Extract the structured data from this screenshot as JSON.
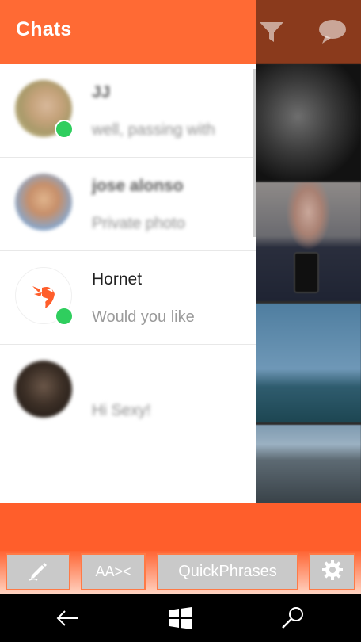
{
  "drawer": {
    "title": "Chats"
  },
  "chats": [
    {
      "name": "JJ",
      "preview": "well, passing with",
      "online": true
    },
    {
      "name": "jose alonso",
      "preview": "Private photo",
      "online": false
    },
    {
      "name": "Hornet",
      "preview": "Would you like",
      "online": true
    },
    {
      "name": "",
      "preview": "Hi Sexy!",
      "online": false
    }
  ],
  "action_bar": {
    "compose_icon": "pencil-icon",
    "text_size_label": "AA><",
    "quickphrases_label": "QuickPhrases",
    "settings_icon": "gear-icon"
  },
  "header_icons": [
    "filter-icon",
    "chat-bubble-icon"
  ],
  "system_nav": [
    "back-icon",
    "windows-icon",
    "search-icon"
  ],
  "colors": {
    "accent": "#ff6a34",
    "online": "#2fce5e"
  }
}
